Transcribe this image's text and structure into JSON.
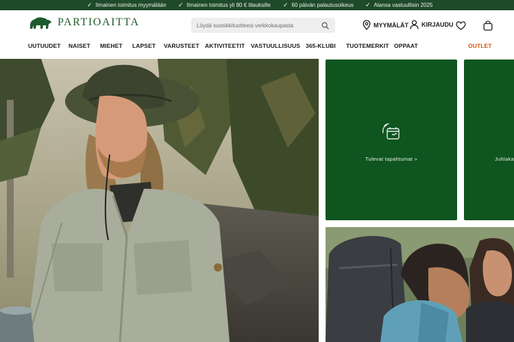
{
  "promo_bar": {
    "items": [
      "Ilmainen toimitus myymälään",
      "Ilmainen toimitus yli 80 € tilauksille",
      "60 päivän palautusoikeus",
      "Alansa vastuullisin 2025"
    ]
  },
  "header": {
    "logo_text": "PARTIOAITTA",
    "search_placeholder": "Löydä suosikkituotteesi verkkokaupasta",
    "stores_label": "MYYMÄLÄT",
    "login_label": "KIRJAUDU"
  },
  "nav": {
    "items": [
      "UUTUUDET",
      "NAISET",
      "MIEHET",
      "LAPSET",
      "VARUSTEET",
      "AKTIVITEETIT",
      "VASTUULLISUUS",
      "365-KLUBI",
      "TUOTEMERKIT",
      "OPPAAT"
    ],
    "outlet": "OUTLET"
  },
  "tiles": {
    "events_label": "Tulevat tapahtumat »",
    "second_label": "Juhlaka"
  },
  "colors": {
    "brand_dark_green": "#1f4a2a",
    "tile_green": "#0e5520",
    "logo_green": "#1e5b2c",
    "outlet_orange": "#d5541a"
  }
}
